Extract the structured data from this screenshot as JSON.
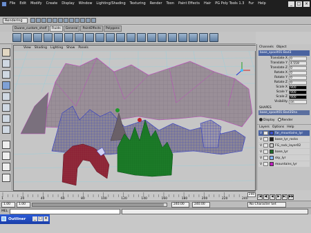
{
  "menubar": {
    "items": [
      "File",
      "Edit",
      "Modify",
      "Create",
      "Display",
      "Window",
      "Lighting/Shading",
      "Texturing",
      "Render",
      "Toon",
      "Paint Effects",
      "Hair",
      "PG Poly Tools 1.3",
      "Fur",
      "Help"
    ],
    "controls": [
      "_",
      "□",
      "×"
    ]
  },
  "toolbar": {
    "mode": "Rendering"
  },
  "shelf": {
    "tabs": [
      "Duane_custom_shelf",
      "Fluids",
      "General",
      "PaintEffects",
      "Polygons"
    ],
    "active_tab": "Fluids"
  },
  "viewport": {
    "menu": [
      "View",
      "Shading",
      "Lighting",
      "Show",
      "Panels"
    ],
    "colors": {
      "background": "#c6c6c6",
      "grid": "#7ec8d8",
      "mesh_gray": "#5a5060",
      "mesh_blue": "#2d38c8",
      "mesh_green": "#1f8a2a",
      "mesh_red": "#b0202a"
    }
  },
  "channelbox": {
    "tabs": [
      "Channels",
      "Object"
    ],
    "object": "base_spoolt01:Bad3",
    "attributes": [
      {
        "name": "Translate X",
        "value": "0"
      },
      {
        "name": "Translate Y",
        "value": "4.559"
      },
      {
        "name": "Translate Z",
        "value": "0"
      },
      {
        "name": "Rotate X",
        "value": "0"
      },
      {
        "name": "Rotate Y",
        "value": "0"
      },
      {
        "name": "Rotate Z",
        "value": "0"
      },
      {
        "name": "Scale X",
        "value": "900"
      },
      {
        "name": "Scale Y",
        "value": "900"
      },
      {
        "name": "Scale Z",
        "value": "900"
      },
      {
        "name": "Visibility",
        "value": "on"
      }
    ],
    "shapes_label": "SHAPES",
    "shape_name": "base_spoolt01:Bad3Sha",
    "display_options": [
      "Display",
      "Render"
    ],
    "layer_menu": [
      "Layers",
      "Options",
      "Help"
    ],
    "layers": [
      {
        "v": "V",
        "name": "far_mountains_lyr",
        "color": "#3a4fd0"
      },
      {
        "v": "V",
        "name": "base_lyr_rocks",
        "color": "#222222"
      },
      {
        "v": "V",
        "name": "FG_rock_layer02",
        "color": "#d0d0d0"
      },
      {
        "v": "V",
        "name": "base_lyr",
        "color": "#1e6a2a"
      },
      {
        "v": "V",
        "name": "sky_lyr",
        "color": "#86b8ff"
      },
      {
        "v": "V",
        "name": "mountains_lyr",
        "color": "#c020c0"
      }
    ]
  },
  "timeline": {
    "ticks": [
      "1",
      "20",
      "40",
      "60",
      "80",
      "100",
      "120",
      "140",
      "160",
      "180",
      "200",
      "220",
      "240"
    ],
    "current": "240",
    "playback": [
      "|◀",
      "◀|",
      "◀",
      "▶",
      "▶|",
      "▶▶"
    ]
  },
  "range": {
    "start": "1.00",
    "range_start": "1.00",
    "range_end": "240.00",
    "end": "240.00",
    "character": "No Character Set"
  },
  "cmdline": {
    "label": "MEL"
  },
  "taskbar": {
    "title": "Outliner"
  }
}
